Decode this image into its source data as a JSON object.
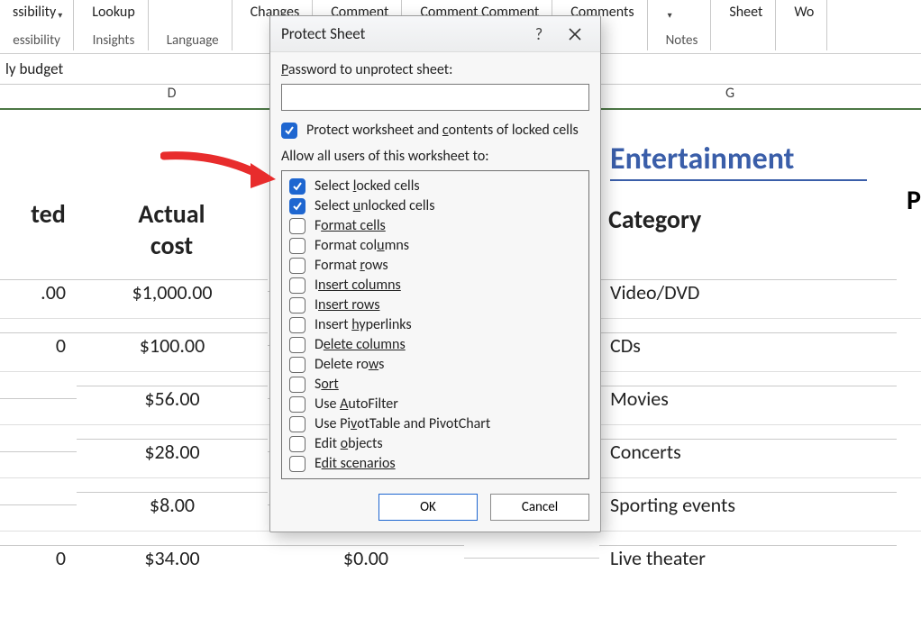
{
  "ribbon": {
    "groups": [
      {
        "top": "ssibility",
        "topHasChevron": true,
        "bottom": "essibility"
      },
      {
        "top": "Lookup",
        "topHasChevron": false,
        "bottom": "Insights"
      },
      {
        "top": "",
        "topHasChevron": false,
        "bottom": "Language"
      },
      {
        "top": "Changes",
        "topHasChevron": false,
        "bottom": ""
      },
      {
        "top": "Comment",
        "topHasChevron": false,
        "bottom": ""
      },
      {
        "top": "Comment Comment",
        "topHasChevron": false,
        "bottom": ""
      },
      {
        "top": "Comments",
        "topHasChevron": false,
        "bottom": ""
      },
      {
        "top": "",
        "topHasChevron": true,
        "bottom": "Notes"
      },
      {
        "top": "Sheet",
        "topHasChevron": false,
        "bottom": ""
      },
      {
        "top": "Wo",
        "topHasChevron": false,
        "bottom": ""
      }
    ]
  },
  "name_box": "ly budget",
  "column_headers": {
    "D": "D",
    "G": "G"
  },
  "left_block": {
    "col_c_header": [
      "ted",
      ""
    ],
    "col_d_header": [
      "Actual",
      "cost"
    ],
    "rows": [
      {
        "c": ".00",
        "d": "$1,000.00"
      },
      {
        "c": "0",
        "d": "$100.00"
      },
      {
        "c": "",
        "d": "$56.00"
      },
      {
        "c": "",
        "d": "$28.00"
      },
      {
        "c": "",
        "d": "$8.00"
      },
      {
        "c": "0",
        "d": "$34.00"
      }
    ],
    "e_value_last": "$0.00"
  },
  "right_block": {
    "section_title": "Entertainment",
    "header": "Category",
    "right_edge_header": "P",
    "items": [
      "Video/DVD",
      "CDs",
      "Movies",
      "Concerts",
      "Sporting events",
      "Live theater"
    ]
  },
  "dialog": {
    "title": "Protect Sheet",
    "help": "?",
    "password_label_parts": [
      "P",
      "assword to unprotect sheet:"
    ],
    "password_value": "",
    "protect_contents_parts": [
      "Protect worksheet and ",
      "c",
      "ontents of locked cells"
    ],
    "protect_contents_checked": true,
    "allow_label": "Allow all users of this worksheet to:",
    "permissions": [
      {
        "label_parts": [
          "Select ",
          "l",
          "ocked cells"
        ],
        "checked": true
      },
      {
        "label_parts": [
          "Select ",
          "u",
          "nlocked cells"
        ],
        "checked": true
      },
      {
        "label_parts": [
          "F",
          "ormat cells"
        ],
        "checked": false
      },
      {
        "label_parts": [
          "Format col",
          "u",
          "mns"
        ],
        "checked": false
      },
      {
        "label_parts": [
          "Format ",
          "r",
          "ows"
        ],
        "checked": false
      },
      {
        "label_parts": [
          "I",
          "nsert columns"
        ],
        "checked": false
      },
      {
        "label_parts": [
          "I",
          "nsert rows"
        ],
        "checked": false
      },
      {
        "label_parts": [
          "Insert ",
          "h",
          "yperlinks"
        ],
        "checked": false
      },
      {
        "label_parts": [
          "D",
          "elete columns"
        ],
        "checked": false
      },
      {
        "label_parts": [
          "Delete ro",
          "w",
          "s"
        ],
        "checked": false
      },
      {
        "label_parts": [
          "S",
          "ort"
        ],
        "checked": false
      },
      {
        "label_parts": [
          "Use ",
          "A",
          "utoFilter"
        ],
        "checked": false
      },
      {
        "label_parts": [
          "Use Pi",
          "v",
          "otTable and PivotChart"
        ],
        "checked": false
      },
      {
        "label_parts": [
          "Edit ",
          "o",
          "bjects"
        ],
        "checked": false
      },
      {
        "label_parts": [
          "E",
          "dit scenarios"
        ],
        "checked": false
      }
    ],
    "ok": "OK",
    "cancel": "Cancel"
  }
}
